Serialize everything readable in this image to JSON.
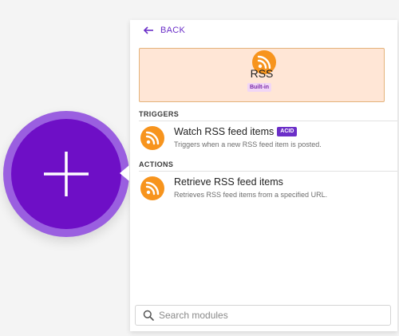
{
  "panel": {
    "back_label": "BACK",
    "app": {
      "name": "RSS",
      "badge": "Built-in",
      "icon": "rss-icon"
    },
    "sections": {
      "triggers_label": "TRIGGERS",
      "actions_label": "ACTIONS"
    },
    "modules": {
      "watch": {
        "title": "Watch RSS feed items",
        "badge": "ACID",
        "description": "Triggers when a new RSS feed item is posted.",
        "icon": "rss-icon"
      },
      "retrieve": {
        "title": "Retrieve RSS feed items",
        "description": "Retrieves RSS feed items from a specified URL.",
        "icon": "rss-icon"
      }
    },
    "search": {
      "placeholder": "Search modules",
      "value": ""
    }
  },
  "add_module": {
    "icon": "plus-icon"
  },
  "colors": {
    "accent": "#6b2fc8",
    "module_circle": "#6e0fc6",
    "module_ring": "#9a5fe0",
    "rss_orange": "#f7941d",
    "app_card_bg": "#ffe6d6"
  }
}
